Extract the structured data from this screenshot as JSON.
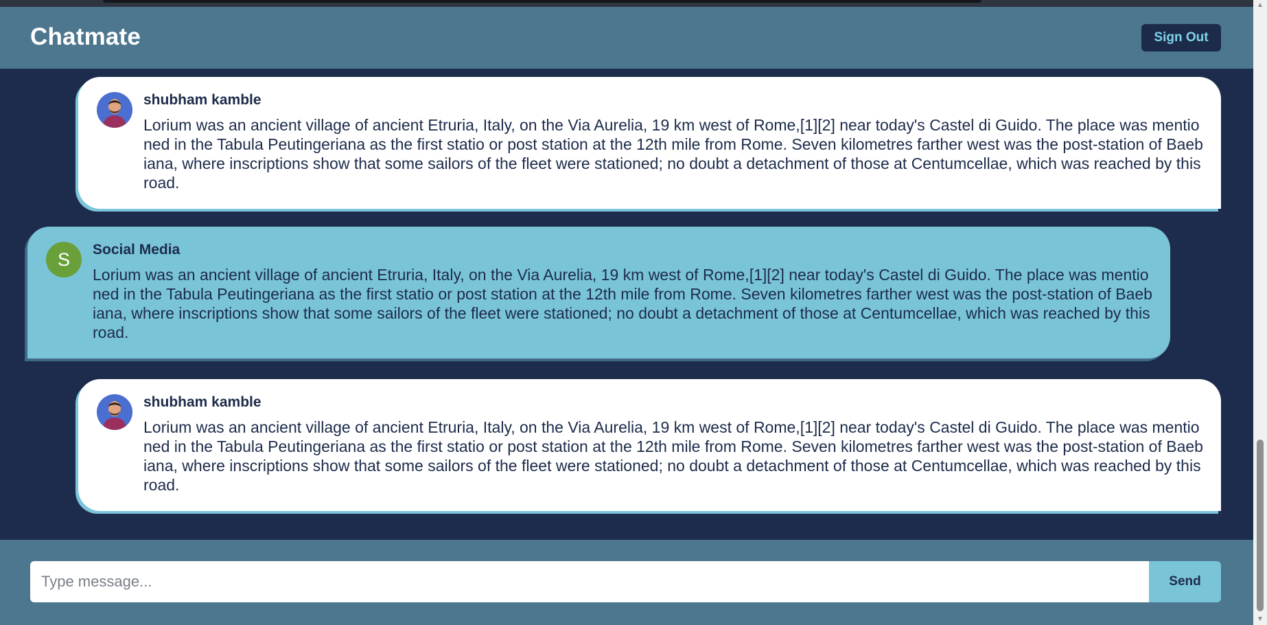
{
  "app": {
    "title": "Chatmate",
    "sign_out_label": "Sign Out"
  },
  "messages": [
    {
      "author": "shubham kamble",
      "avatar": "user-photo-avatar",
      "text": "Lorium was an ancient village of ancient Etruria, Italy, on the Via Aurelia, 19 km west of Rome,[1][2] near today's Castel di Guido. The place was mentioned in the Tabula Peutingeriana as the first statio or post station at the 12th mile from Rome. Seven kilometres farther west was the post-station of Baebiana, where inscriptions show that some sailors of the fleet were stationed; no doubt a detachment of those at Centumcellae, which was reached by this road."
    },
    {
      "author": "Social Media",
      "avatar_letter": "S",
      "text": "Lorium was an ancient village of ancient Etruria, Italy, on the Via Aurelia, 19 km west of Rome,[1][2] near today's Castel di Guido. The place was mentioned in the Tabula Peutingeriana as the first statio or post station at the 12th mile from Rome. Seven kilometres farther west was the post-station of Baebiana, where inscriptions show that some sailors of the fleet were stationed; no doubt a detachment of those at Centumcellae, which was reached by this road."
    },
    {
      "author": "shubham kamble",
      "avatar": "user-photo-avatar",
      "text": "Lorium was an ancient village of ancient Etruria, Italy, on the Via Aurelia, 19 km west of Rome,[1][2] near today's Castel di Guido. The place was mentioned in the Tabula Peutingeriana as the first statio or post station at the 12th mile from Rome. Seven kilometres farther west was the post-station of Baebiana, where inscriptions show that some sailors of the fleet were stationed; no doubt a detachment of those at Centumcellae, which was reached by this road."
    }
  ],
  "composer": {
    "placeholder": "Type message...",
    "value": "",
    "send_label": "Send"
  },
  "colors": {
    "header_bg": "#4d768f",
    "chat_bg": "#1d2c4d",
    "own_bubble": "#ffffff",
    "other_bubble": "#7ac4d8",
    "accent": "#7fd3ea",
    "text_dark": "#1c2b4a",
    "avatar_green": "#6aa03a"
  }
}
